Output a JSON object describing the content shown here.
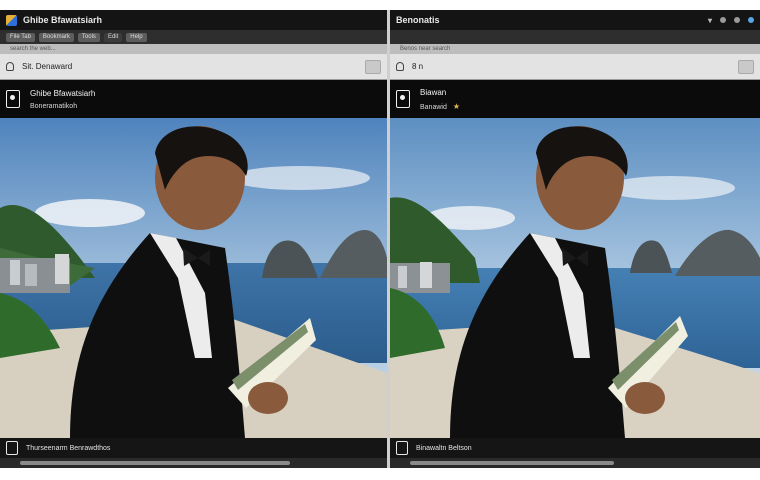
{
  "left_window": {
    "title": "Ghibe Bfawatsiarh",
    "toolbar": [
      "File Tab",
      "Bookmark",
      "Tools",
      "Edit",
      "Help"
    ],
    "url_hint": "search the web...",
    "address": "Sit. Denaward",
    "profile_name": "Ghibe Bfawatsiarh",
    "profile_sub": "Boneramatikoh",
    "footer": "Thurseenarm Benrawdthos",
    "scroll_fraction": 0.75
  },
  "right_window": {
    "title": "Benonatis",
    "url_hint": "Benos near search",
    "address": "8 n",
    "profile_name": "Biawan",
    "profile_sub": "Banawid",
    "footer": "Binawaltn Beltson",
    "scroll_fraction": 0.6
  },
  "icons": {
    "app": "app-icon",
    "lock": "lock-icon",
    "avatar": "avatar-icon",
    "star": "star-icon",
    "page": "page-icon"
  },
  "colors": {
    "titlebar": "#141414",
    "toolbar": "#2e2e2e",
    "address_bg": "#e3e3e3",
    "profile_bg": "#0b0b0b",
    "accent_star": "#e0b84a",
    "sky": "#5d8fc2",
    "sea": "#3f74a8"
  }
}
